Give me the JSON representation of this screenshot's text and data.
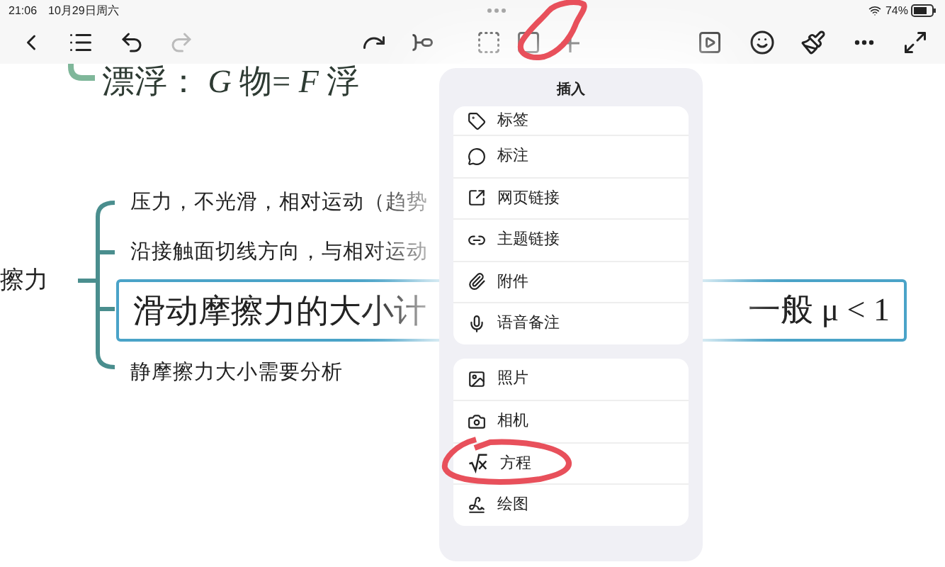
{
  "status_bar": {
    "time": "21:06",
    "date": "10月29日周六",
    "battery": "74%"
  },
  "toolbar": [
    {
      "kind": "back",
      "disabled": false
    },
    {
      "kind": "outline",
      "disabled": false
    },
    {
      "kind": "undo",
      "disabled": false
    },
    {
      "kind": "redo",
      "disabled": true
    },
    {
      "kind": "relationship",
      "disabled": false
    },
    {
      "kind": "subtopic",
      "disabled": false
    },
    {
      "kind": "select",
      "disabled": false
    },
    {
      "kind": "boundary",
      "disabled": false
    },
    {
      "kind": "insert",
      "disabled": false
    },
    {
      "kind": "present",
      "disabled": false
    },
    {
      "kind": "sticker",
      "disabled": false
    },
    {
      "kind": "format",
      "disabled": false
    },
    {
      "kind": "more",
      "disabled": false
    },
    {
      "kind": "fullscreen",
      "disabled": false
    }
  ],
  "mind_map": {
    "top_node": "漂浮：  *G* 物= *F* 浮",
    "root": "擦力",
    "branches": [
      {
        "kind": "text",
        "text": "压力，不光滑，相对运动（趋势",
        "selected": false
      },
      {
        "kind": "text",
        "text": "沿接触面切线方向，与相对运动",
        "selected": false
      },
      {
        "kind": "heading",
        "text": "滑动摩擦力的大小计",
        "text_end": "一般 μ < 1",
        "selected": true
      },
      {
        "kind": "text",
        "text": "静摩擦力大小需要分析",
        "selected": false
      }
    ]
  },
  "insert_menu": {
    "title": "插入",
    "groups": [
      [
        {
          "kind": "tag",
          "label": "标签"
        },
        {
          "kind": "callout",
          "label": "标注"
        },
        {
          "kind": "web",
          "label": "网页链接"
        },
        {
          "kind": "topic",
          "label": "主题链接"
        },
        {
          "kind": "attachment",
          "label": "附件"
        },
        {
          "kind": "voice",
          "label": "语音备注"
        }
      ],
      [
        {
          "kind": "photo",
          "label": "照片"
        },
        {
          "kind": "camera",
          "label": "相机"
        },
        {
          "kind": "equation",
          "label": "方程"
        },
        {
          "kind": "drawing",
          "label": "绘图"
        }
      ]
    ]
  }
}
